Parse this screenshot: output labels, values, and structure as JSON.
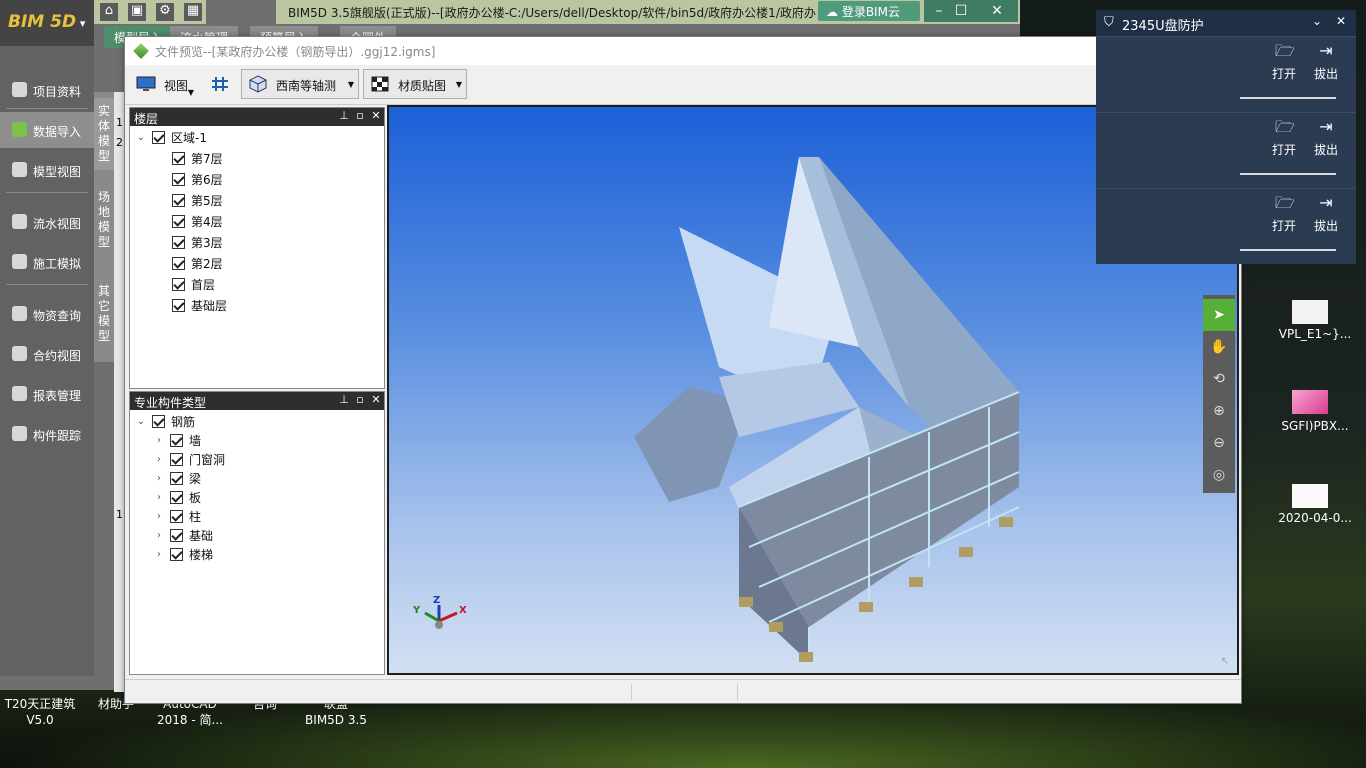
{
  "desktop": {
    "items": [
      {
        "label": "VPL_E1~}..."
      },
      {
        "label": "SGFI)PBX..."
      },
      {
        "label": "2020-04-0..."
      }
    ],
    "taskbar_labels": [
      {
        "line1": "T20天正建筑",
        "line2": "V5.0"
      },
      {
        "line1": "材助手",
        "line2": ""
      },
      {
        "line1": "AutoCAD",
        "line2": "2018 - 简..."
      },
      {
        "line1": "咨询",
        "line2": ""
      },
      {
        "line1": "联盟",
        "line2": "BIM5D 3.5"
      }
    ]
  },
  "parent_app": {
    "logo": "BIM 5D",
    "title": "BIM5D 3.5旗舰版(正式版)--[政府办公楼-C:/Users/dell/Desktop/软件/bin5d/政府办公楼1/政府办",
    "login_label": "登录BIM云",
    "tabs": [
      "模型导入",
      "流水管理",
      "预算导入",
      "合同外"
    ],
    "vertical_tabs": [
      "实体模型",
      "场地模型",
      "其它模型"
    ],
    "sidebar": [
      {
        "label": "项目资料",
        "icon": "layers-icon"
      },
      {
        "label": "数据导入",
        "icon": "import-icon"
      },
      {
        "label": "模型视图",
        "icon": "model-icon"
      },
      {
        "label": "流水视图",
        "icon": "flow-icon"
      },
      {
        "label": "施工模拟",
        "icon": "worker-icon"
      },
      {
        "label": "物资查询",
        "icon": "search-icon"
      },
      {
        "label": "合约视图",
        "icon": "contract-icon"
      },
      {
        "label": "报表管理",
        "icon": "report-icon"
      },
      {
        "label": "构件跟踪",
        "icon": "monitor-icon"
      }
    ],
    "row_numbers": [
      "1",
      "2",
      "1"
    ]
  },
  "dialog": {
    "title": "文件预览--[某政府办公楼（钢筋导出）.ggj12.igms]",
    "toolbar": {
      "view_label": "视图",
      "iso_label": "西南等轴测",
      "material_label": "材质贴图"
    },
    "floors_panel": {
      "title": "楼层",
      "root": "区域-1",
      "items": [
        "第7层",
        "第6层",
        "第5层",
        "第4层",
        "第3层",
        "第2层",
        "首层",
        "基础层"
      ]
    },
    "types_panel": {
      "title": "专业构件类型",
      "root": "钢筋",
      "items": [
        "墙",
        "门窗洞",
        "梁",
        "板",
        "柱",
        "基础",
        "楼梯"
      ]
    },
    "axes": {
      "x": "X",
      "y": "Y",
      "z": "Z"
    }
  },
  "usb_panel": {
    "title": "2345U盘防护",
    "rows": [
      {
        "open": "打开",
        "eject": "拔出"
      },
      {
        "open": "打开",
        "eject": "拔出"
      },
      {
        "open": "打开",
        "eject": "拔出"
      }
    ]
  },
  "colors": {
    "accent_green": "#57b035",
    "viewport_top": "#1c60d8",
    "usb_bg": "#1f2f45"
  }
}
